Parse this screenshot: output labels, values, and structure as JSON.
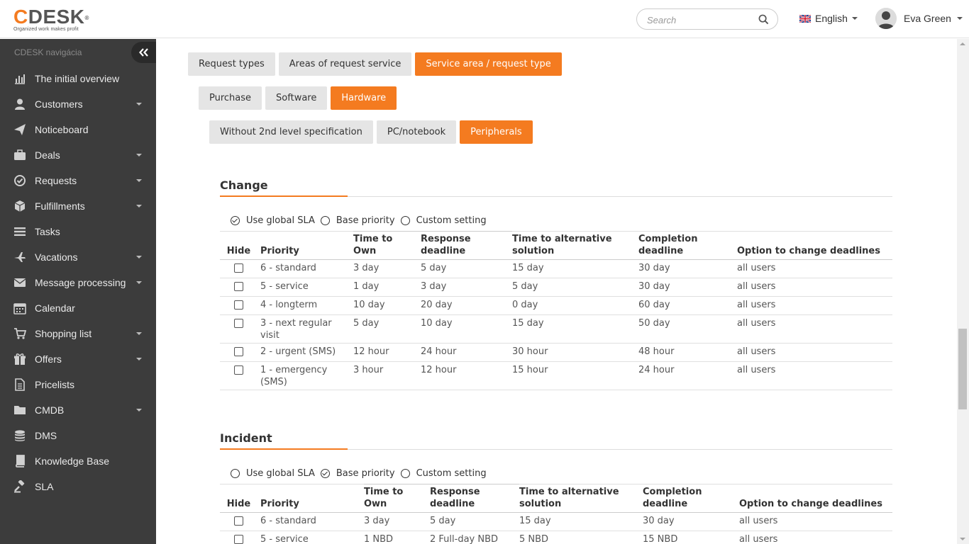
{
  "header": {
    "logo_text": "CDESK",
    "logo_registered": "®",
    "logo_tagline": "Organized work makes profit",
    "search_placeholder": "Search",
    "language": "English",
    "user_name": "Eva Green"
  },
  "sidebar": {
    "title": "CDESK navigácia",
    "collapse_icon": "double-chevron-left-icon",
    "items": [
      {
        "label": "The initial overview",
        "icon": "bar-chart-icon",
        "has_submenu": false
      },
      {
        "label": "Customers",
        "icon": "user-icon",
        "has_submenu": true
      },
      {
        "label": "Noticeboard",
        "icon": "paper-plane-icon",
        "has_submenu": false
      },
      {
        "label": "Deals",
        "icon": "briefcase-icon",
        "has_submenu": true
      },
      {
        "label": "Requests",
        "icon": "check-circle-icon",
        "has_submenu": true
      },
      {
        "label": "Fulfillments",
        "icon": "cube-icon",
        "has_submenu": true
      },
      {
        "label": "Tasks",
        "icon": "list-icon",
        "has_submenu": false
      },
      {
        "label": "Vacations",
        "icon": "plane-icon",
        "has_submenu": true
      },
      {
        "label": "Message processing",
        "icon": "envelope-icon",
        "has_submenu": true
      },
      {
        "label": "Calendar",
        "icon": "calendar-icon",
        "has_submenu": false
      },
      {
        "label": "Shopping list",
        "icon": "cart-icon",
        "has_submenu": true
      },
      {
        "label": "Offers",
        "icon": "gift-icon",
        "has_submenu": true
      },
      {
        "label": "Pricelists",
        "icon": "document-icon",
        "has_submenu": false
      },
      {
        "label": "CMDB",
        "icon": "folder-icon",
        "has_submenu": true
      },
      {
        "label": "DMS",
        "icon": "database-icon",
        "has_submenu": false
      },
      {
        "label": "Knowledge Base",
        "icon": "book-icon",
        "has_submenu": false
      },
      {
        "label": "SLA",
        "icon": "gavel-icon",
        "has_submenu": false
      }
    ]
  },
  "tabs_level1": [
    {
      "label": "Request types",
      "active": false
    },
    {
      "label": "Areas of request service",
      "active": false
    },
    {
      "label": "Service area / request type",
      "active": true
    }
  ],
  "tabs_level2": [
    {
      "label": "Purchase",
      "active": false
    },
    {
      "label": "Software",
      "active": false
    },
    {
      "label": "Hardware",
      "active": true
    }
  ],
  "tabs_level3": [
    {
      "label": "Without 2nd level specification",
      "active": false
    },
    {
      "label": "PC/notebook",
      "active": false
    },
    {
      "label": "Peripherals",
      "active": true
    }
  ],
  "radio_labels": {
    "global": "Use global SLA",
    "base": "Base priority",
    "custom": "Custom setting"
  },
  "columns": {
    "hide": "Hide",
    "priority": "Priority",
    "time_to_own": "Time to Own",
    "response_deadline": "Response deadline",
    "time_to_alternative": "Time to alternative solution",
    "completion_deadline": "Completion deadline",
    "option_to_change": "Option to change deadlines"
  },
  "sections": [
    {
      "title": "Change",
      "selected_radio": "global",
      "rows": [
        {
          "priority": "6 - standard",
          "own": "3 day",
          "response": "5 day",
          "alternative": "15 day",
          "completion": "30 day",
          "option": "all users"
        },
        {
          "priority": "5 - service",
          "own": "1 day",
          "response": "3 day",
          "alternative": "5 day",
          "completion": "30 day",
          "option": "all users"
        },
        {
          "priority": "4 - longterm",
          "own": "10 day",
          "response": "20 day",
          "alternative": "0 day",
          "completion": "60 day",
          "option": "all users"
        },
        {
          "priority": "3 - next regular visit",
          "own": "5 day",
          "response": "10 day",
          "alternative": "15 day",
          "completion": "50 day",
          "option": "all users"
        },
        {
          "priority": "2 - urgent (SMS)",
          "own": "12 hour",
          "response": "24 hour",
          "alternative": "30 hour",
          "completion": "48 hour",
          "option": "all users"
        },
        {
          "priority": "1 - emergency (SMS)",
          "own": "3 hour",
          "response": "12 hour",
          "alternative": "15 hour",
          "completion": "24 hour",
          "option": "all users"
        }
      ]
    },
    {
      "title": "Incident",
      "selected_radio": "base",
      "rows": [
        {
          "priority": "6 - standard",
          "own": "3 day",
          "response": "5 day",
          "alternative": "15 day",
          "completion": "30 day",
          "option": "all users"
        },
        {
          "priority": "5 - service",
          "own": "1 NBD",
          "response": "2 Full-day NBD",
          "alternative": "5 NBD",
          "completion": "15 NBD",
          "option": "all users"
        }
      ]
    }
  ],
  "colors": {
    "accent": "#f47b20",
    "sidebar_bg": "#3c3c3c",
    "tab_bg": "#e5e5e5"
  }
}
